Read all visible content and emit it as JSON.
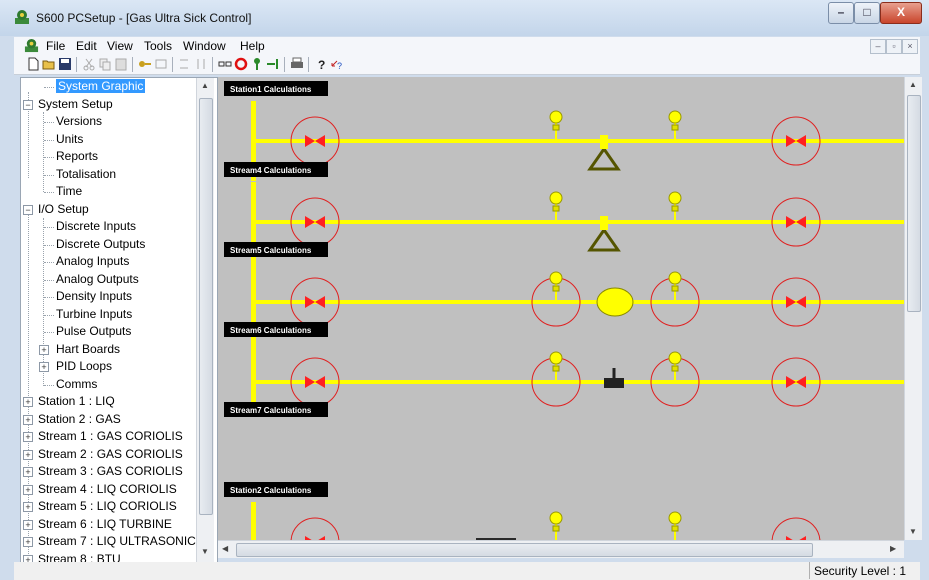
{
  "window": {
    "title": "S600 PCSetup  - [Gas Ultra Sick Control]",
    "controls": [
      "–",
      "□",
      "X"
    ]
  },
  "menu": [
    "File",
    "Edit",
    "View",
    "Tools",
    "Window",
    "Help"
  ],
  "mdi_controls": [
    "–",
    "▫",
    "×"
  ],
  "tree": {
    "items": [
      {
        "label": "System Graphic",
        "level": 1,
        "expander": "",
        "selected": true
      },
      {
        "label": "System Setup",
        "level": 0,
        "expander": "−"
      },
      {
        "label": "Versions",
        "level": 1,
        "expander": ""
      },
      {
        "label": "Units",
        "level": 1,
        "expander": ""
      },
      {
        "label": "Reports",
        "level": 1,
        "expander": ""
      },
      {
        "label": "Totalisation",
        "level": 1,
        "expander": ""
      },
      {
        "label": "Time",
        "level": 1,
        "expander": ""
      },
      {
        "label": "I/O Setup",
        "level": 0,
        "expander": "−"
      },
      {
        "label": "Discrete Inputs",
        "level": 1,
        "expander": ""
      },
      {
        "label": "Discrete Outputs",
        "level": 1,
        "expander": ""
      },
      {
        "label": "Analog Inputs",
        "level": 1,
        "expander": ""
      },
      {
        "label": "Analog Outputs",
        "level": 1,
        "expander": ""
      },
      {
        "label": "Density Inputs",
        "level": 1,
        "expander": ""
      },
      {
        "label": "Turbine Inputs",
        "level": 1,
        "expander": ""
      },
      {
        "label": "Pulse Outputs",
        "level": 1,
        "expander": ""
      },
      {
        "label": "Hart Boards",
        "level": 1,
        "expander": "+"
      },
      {
        "label": "PID Loops",
        "level": 1,
        "expander": "+"
      },
      {
        "label": "Comms",
        "level": 1,
        "expander": ""
      },
      {
        "label": "Station 1 : LIQ",
        "level": 0,
        "expander": "+"
      },
      {
        "label": "Station 2 : GAS",
        "level": 0,
        "expander": "+"
      },
      {
        "label": "Stream 1 : GAS CORIOLIS",
        "level": 0,
        "expander": "+"
      },
      {
        "label": "Stream 2 : GAS CORIOLIS",
        "level": 0,
        "expander": "+"
      },
      {
        "label": "Stream 3 : GAS CORIOLIS",
        "level": 0,
        "expander": "+"
      },
      {
        "label": "Stream 4 : LIQ CORIOLIS",
        "level": 0,
        "expander": "+"
      },
      {
        "label": "Stream 5 : LIQ CORIOLIS",
        "level": 0,
        "expander": "+"
      },
      {
        "label": "Stream 6 : LIQ TURBINE",
        "level": 0,
        "expander": "+"
      },
      {
        "label": "Stream 7 : LIQ ULTRASONIC",
        "level": 0,
        "expander": "+"
      },
      {
        "label": "Stream 8 : BTU",
        "level": 0,
        "expander": "+"
      }
    ]
  },
  "canvas": {
    "background": "#c0c0c0",
    "pipe_color": "#ffff00",
    "valve_color": "#ff2020",
    "rows": [
      {
        "label": "Station1 Calculations",
        "meter": "coriolis",
        "circled_mid": false,
        "has_pipe": true
      },
      {
        "label": "Stream4 Calculations",
        "meter": "coriolis",
        "circled_mid": false,
        "has_pipe": true
      },
      {
        "label": "Stream5 Calculations",
        "meter": "turbine",
        "circled_mid": true,
        "has_pipe": true
      },
      {
        "label": "Stream6 Calculations",
        "meter": "orifice",
        "circled_mid": true,
        "has_pipe": true
      },
      {
        "label": "Stream7 Calculations",
        "meter": "none",
        "circled_mid": false,
        "has_pipe": false
      },
      {
        "label": "Station2 Calculations",
        "meter": "ultrasonic",
        "circled_mid": false,
        "has_pipe": true
      }
    ]
  },
  "status": {
    "security": "Security Level : 1"
  }
}
